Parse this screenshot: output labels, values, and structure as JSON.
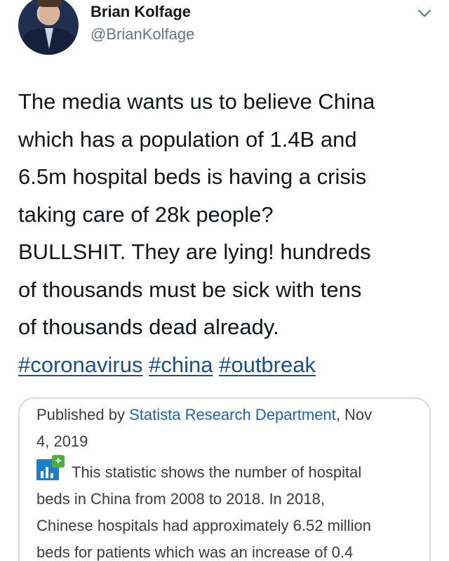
{
  "author": {
    "name": "Brian Kolfage",
    "handle": "@BrianKolfage",
    "avatar_icon": "profile-photo"
  },
  "menu_icon": "chevron-down-icon",
  "tweet": {
    "lines": [
      "The media wants us to believe China",
      "which has a population of 1.4B and",
      "6.5m hospital beds is having a crisis",
      "taking care of 28k people?",
      "BULLSHIT. They are lying!  hundreds",
      "of thousands must be sick with tens",
      "of thousands dead already."
    ],
    "hashtags": [
      "#coronavirus",
      "#china",
      "#outbreak"
    ]
  },
  "card": {
    "published_prefix": "Published by ",
    "publisher": "Statista Research Department",
    "published_date_part1": ", Nov",
    "published_date_part2": "4, 2019",
    "description_lines": [
      "This statistic shows the number of hospital",
      "beds in China from 2008 to 2018. In 2018,",
      "Chinese hospitals had approximately 6.52 million",
      "beds for patients which was an increase of 0.4"
    ],
    "stat_icon": "statista-chart-plus-icon"
  },
  "colors": {
    "text": "#14171a",
    "secondary_text": "#657786",
    "hashtag": "#1b4f8a",
    "card_link": "#2163a8",
    "icon_blue": "#1f7cc7",
    "icon_green": "#4caf3e"
  }
}
